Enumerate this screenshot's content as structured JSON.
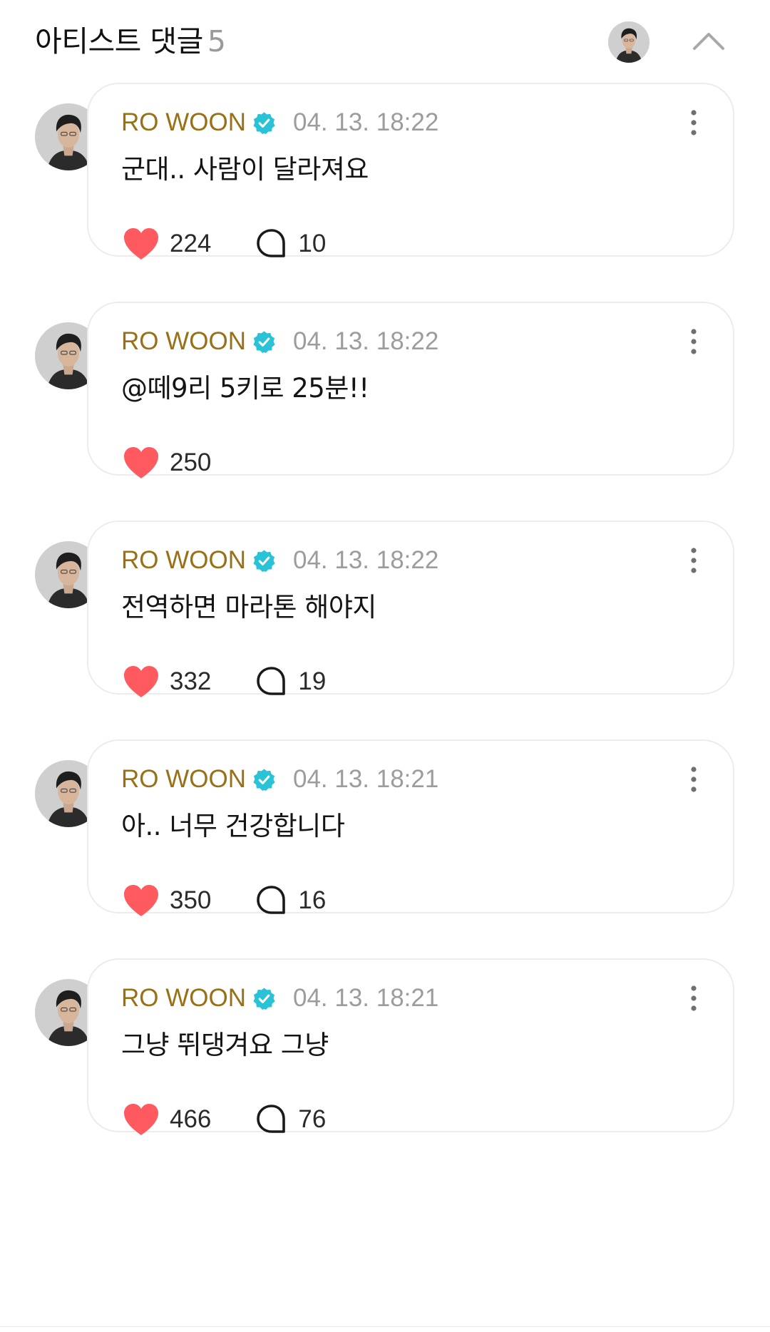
{
  "header": {
    "title": "아티스트 댓글",
    "count": "5",
    "avatar_icon": "artist-avatar",
    "collapse_icon": "chevron-up-icon"
  },
  "colors": {
    "author": "#9a7016",
    "verified": "#29c2d6",
    "heart": "#ff5a5f",
    "timestamp": "#9c9c9c",
    "card_border": "#ececec"
  },
  "comments": [
    {
      "author": "RO WOON",
      "time": "04. 13. 18:22",
      "text": "군대.. 사람이 달라져요",
      "likes": "224",
      "replies": "10"
    },
    {
      "author": "RO WOON",
      "time": "04. 13. 18:22",
      "text": "@떼9리 5키로 25분!!",
      "likes": "250",
      "replies": null
    },
    {
      "author": "RO WOON",
      "time": "04. 13. 18:22",
      "text": "전역하면 마라톤 해야지",
      "likes": "332",
      "replies": "19"
    },
    {
      "author": "RO WOON",
      "time": "04. 13. 18:21",
      "text": "아.. 너무 건강합니다",
      "likes": "350",
      "replies": "16"
    },
    {
      "author": "RO WOON",
      "time": "04. 13. 18:21",
      "text": "그냥 뛰댕겨요 그냥",
      "likes": "466",
      "replies": "76"
    }
  ]
}
